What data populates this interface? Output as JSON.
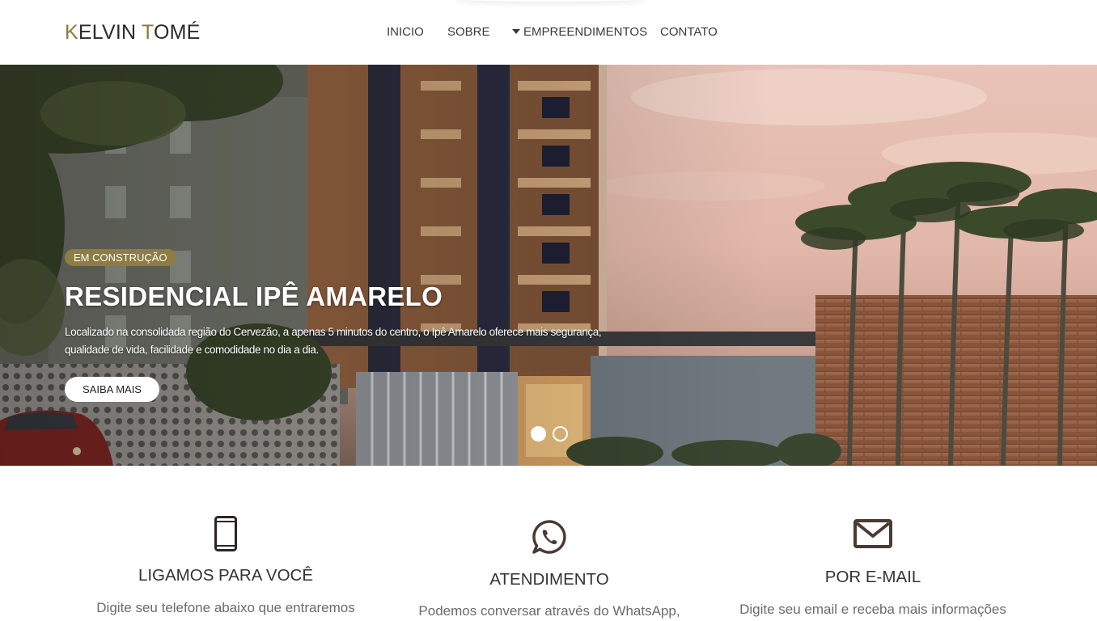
{
  "brand": {
    "part1_initial": "K",
    "part1_rest": "ELVIN ",
    "part2_initial": "T",
    "part2_rest": "OMÉ",
    "accent_color": "#8d7a3d"
  },
  "nav": {
    "items": [
      {
        "label": "INICIO"
      },
      {
        "label": "SOBRE"
      },
      {
        "label": "EMPREENDIMENTOS",
        "icon": "caret-down-icon"
      },
      {
        "label": "CONTATO"
      }
    ]
  },
  "hero": {
    "badge": "EM CONSTRUÇÃO",
    "title": "RESIDENCIAL IPÊ AMARELO",
    "description": "Localizado na consolidada região do Cervezão, a apenas 5 minutos do centro, o Ipê Amarelo oferece mais segurança, qualidade de vida, facilidade e comodidade no dia a dia.",
    "button": "SAIBA MAIS",
    "slides_total": 2,
    "slide_active": 1
  },
  "features": [
    {
      "icon": "smartphone-icon",
      "title": "LIGAMOS PARA VOCÊ",
      "description": "Digite seu telefone abaixo que entraremos"
    },
    {
      "icon": "whatsapp-icon",
      "title": "ATENDIMENTO",
      "description": "Podemos conversar através do WhatsApp,"
    },
    {
      "icon": "envelope-icon",
      "title": "POR E-MAIL",
      "description": "Digite seu email e receba mais informações"
    }
  ],
  "colors": {
    "badge_bg": "#8d7c43",
    "text_dark": "#333333",
    "icon_dark": "#4a3a33"
  }
}
